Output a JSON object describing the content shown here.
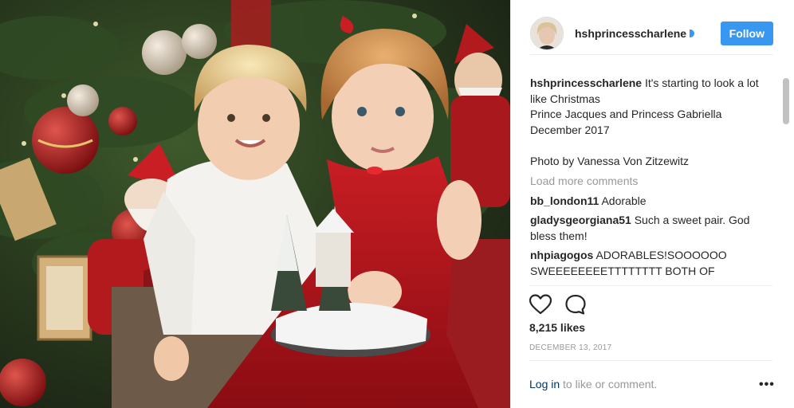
{
  "post": {
    "username": "hshprincesscharlene",
    "follow_label": "Follow",
    "caption_user": "hshprincesscharlene",
    "caption_text": " It's starting to look a lot like Christmas\nPrince Jacques and Princess Gabriella\nDecember 2017\n\nPhoto by Vanessa Von Zitzewitz",
    "load_more": "Load more comments",
    "comments": [
      {
        "user": "bb_london11",
        "text": " Adorable"
      },
      {
        "user": "gladysgeorgiana51",
        "text": " Such a sweet pair. God bless them!"
      },
      {
        "user": "nhpiagogos",
        "text": " ADORABLES!SOOOOOO SWEEEEEEEETTTTTTTT BOTH OF"
      }
    ],
    "likes": "8,215 likes",
    "date": "DECEMBER 13, 2017",
    "login_link": "Log in",
    "login_rest": " to like or comment.",
    "more_label": "•••"
  },
  "icons": {
    "like": "heart-icon",
    "comment": "comment-bubble-icon",
    "verified": "verified-badge-icon",
    "options": "more-options-icon"
  },
  "colors": {
    "accent": "#3897f0",
    "link": "#003569",
    "muted": "#999999",
    "text": "#262626"
  }
}
